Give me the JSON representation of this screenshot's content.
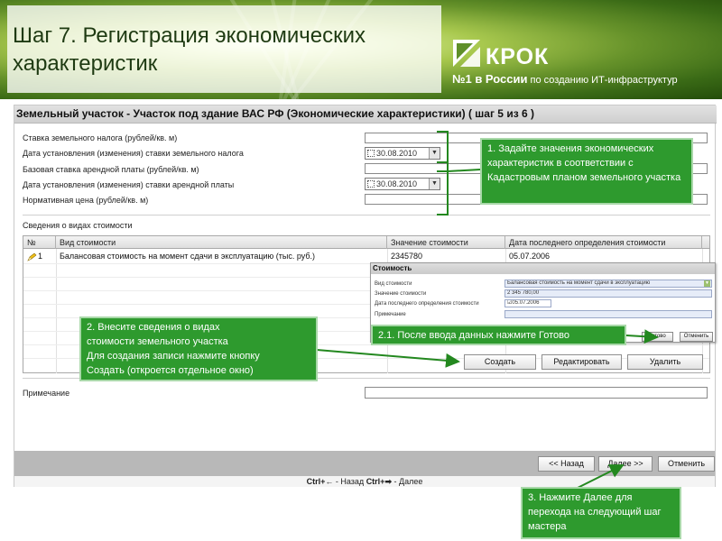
{
  "slide": {
    "title_line1": "Шаг 7. Регистрация экономических",
    "title_line2": "характеристик",
    "logo_text": "КРОК",
    "logo_tagline_big": "№1 в России",
    "logo_tagline_small": " по созданию ИТ-инфраструктур"
  },
  "app": {
    "title": "Земельный участок - Участок под здание ВАС РФ (Экономические характеристики) ( шаг 5 из 6 )",
    "fields": [
      {
        "label": "Ставка земельного налога (рублей/кв. м)"
      },
      {
        "label": "Дата установления (изменения) ставки земельного налога",
        "date": "30.08.2010"
      },
      {
        "label": "Базовая ставка арендной платы (рублей/кв. м)"
      },
      {
        "label": "Дата установления (изменения) ставки арендной платы",
        "date": "30.08.2010"
      },
      {
        "label": "Нормативная цена (рублей/кв. м)"
      }
    ],
    "cost_section_label": "Сведения о видах стоимости",
    "table": {
      "headers": [
        "№",
        "Вид стоимости",
        "Значение стоимости",
        "Дата последнего определения стоимости"
      ],
      "rows": [
        {
          "num": "1",
          "type": "Балансовая стоимость на момент сдачи в эксплуатацию (тыс. руб.)",
          "value": "2345780",
          "date": "05.07.2006"
        }
      ]
    },
    "buttons": {
      "create": "Создать",
      "edit": "Редактировать",
      "delete": "Удалить"
    },
    "note_label": "Примечание",
    "nav": {
      "back": "<< Назад",
      "next": "Далее >>",
      "cancel": "Отменить"
    },
    "status": {
      "prefix": "Ctrl+",
      "back": " - Назад ",
      "mid": "Ctrl+",
      "next": " - Далее"
    }
  },
  "popup": {
    "title": "Стоимость",
    "fields": [
      {
        "label": "Вид стоимости",
        "value": "Балансовая стоимость на момент сдачи в эксплуатацию"
      },
      {
        "label": "Значение стоимости",
        "value": "2 345 780,00"
      },
      {
        "label": "Дата последнего определения стоимости",
        "value": "05.07.2006"
      },
      {
        "label": "Примечание",
        "value": ""
      }
    ],
    "ok": "Готово",
    "cancel": "Отменить"
  },
  "callouts": {
    "c1": "1. Задайте значения экономических характеристик в соответствии с Кадастровым планом земельного участка",
    "c2_lines": [
      "2. Внесите сведения о видах",
      "стоимости земельного участка",
      "Для создания записи нажмите кнопку",
      "Создать (откроется отдельное окно)"
    ],
    "c21": "2.1. После ввода данных нажмите Готово",
    "c3": "3.  Нажмите Далее для перехода на следующий шаг мастера"
  },
  "colors": {
    "callout_green": "#2e9a2e",
    "callout_border": "#a9d8a9",
    "title_text": "#1e3a12",
    "arrow_green": "#23881f"
  }
}
